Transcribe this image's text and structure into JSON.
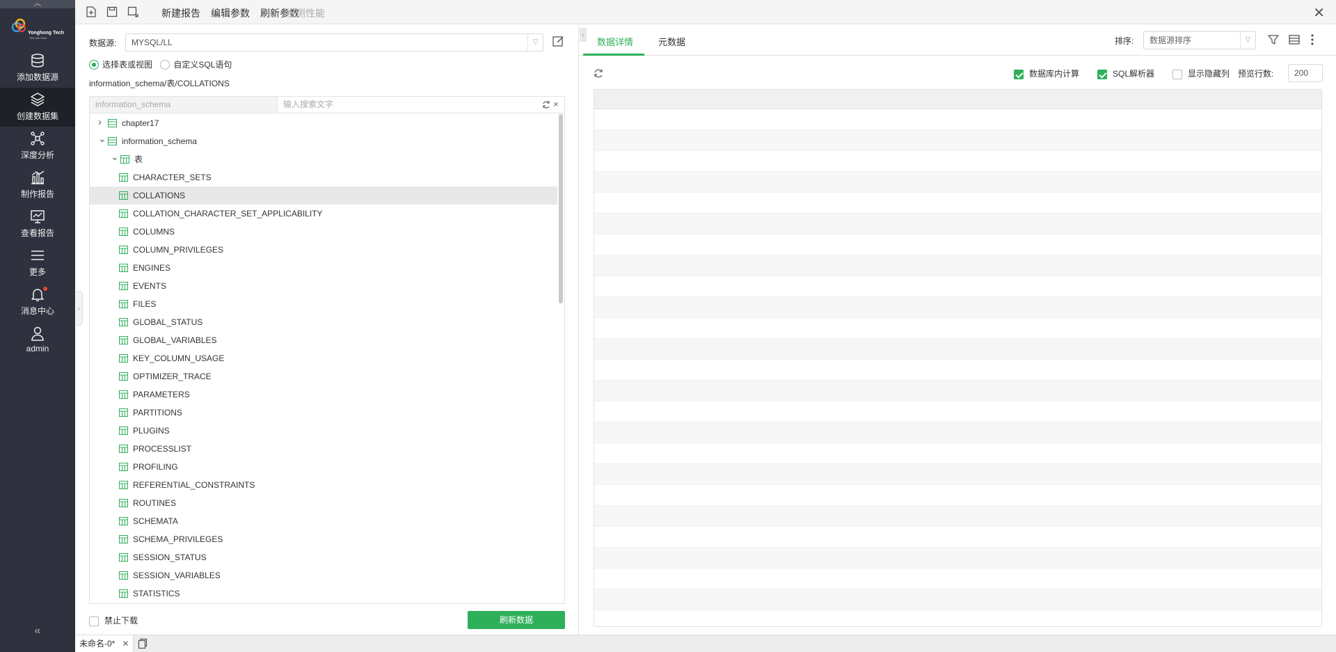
{
  "app": {
    "logo_name": "Yonghong Tech",
    "logo_tagline": "Talk with Data"
  },
  "sidebar": {
    "items": [
      {
        "label": "添加数据源",
        "icon": "database-icon"
      },
      {
        "label": "创建数据集",
        "icon": "layers-icon",
        "active": true
      },
      {
        "label": "深度分析",
        "icon": "network-icon"
      },
      {
        "label": "制作报告",
        "icon": "chart-icon"
      },
      {
        "label": "查看报告",
        "icon": "monitor-chart-icon"
      },
      {
        "label": "更多",
        "icon": "menu-icon"
      },
      {
        "label": "消息中心",
        "icon": "bell-icon"
      },
      {
        "label": "admin",
        "icon": "user-icon"
      }
    ]
  },
  "toolbar": {
    "new_report": "新建报告",
    "edit_params": "编辑参数",
    "refresh_params": "刷新参数",
    "check_perf": "检测性能"
  },
  "left": {
    "datasource_label": "数据源:",
    "datasource_value": "MYSQL/LL",
    "radio_table": "选择表或视图",
    "radio_sql": "自定义SQL语句",
    "path": "information_schema/表/COLLATIONS",
    "tree_db": "information_schema",
    "search_placeholder": "输入搜索文字",
    "tree": [
      {
        "label": "chapter17",
        "level": 0,
        "kind": "db",
        "chev": "right"
      },
      {
        "label": "information_schema",
        "level": 0,
        "kind": "db",
        "chev": "down"
      },
      {
        "label": "表",
        "level": 1,
        "kind": "folder",
        "chev": "down"
      },
      {
        "label": "CHARACTER_SETS",
        "level": 2,
        "kind": "table"
      },
      {
        "label": "COLLATIONS",
        "level": 2,
        "kind": "table",
        "selected": true
      },
      {
        "label": "COLLATION_CHARACTER_SET_APPLICABILITY",
        "level": 2,
        "kind": "table"
      },
      {
        "label": "COLUMNS",
        "level": 2,
        "kind": "table"
      },
      {
        "label": "COLUMN_PRIVILEGES",
        "level": 2,
        "kind": "table"
      },
      {
        "label": "ENGINES",
        "level": 2,
        "kind": "table"
      },
      {
        "label": "EVENTS",
        "level": 2,
        "kind": "table"
      },
      {
        "label": "FILES",
        "level": 2,
        "kind": "table"
      },
      {
        "label": "GLOBAL_STATUS",
        "level": 2,
        "kind": "table"
      },
      {
        "label": "GLOBAL_VARIABLES",
        "level": 2,
        "kind": "table"
      },
      {
        "label": "KEY_COLUMN_USAGE",
        "level": 2,
        "kind": "table"
      },
      {
        "label": "OPTIMIZER_TRACE",
        "level": 2,
        "kind": "table"
      },
      {
        "label": "PARAMETERS",
        "level": 2,
        "kind": "table"
      },
      {
        "label": "PARTITIONS",
        "level": 2,
        "kind": "table"
      },
      {
        "label": "PLUGINS",
        "level": 2,
        "kind": "table"
      },
      {
        "label": "PROCESSLIST",
        "level": 2,
        "kind": "table"
      },
      {
        "label": "PROFILING",
        "level": 2,
        "kind": "table"
      },
      {
        "label": "REFERENTIAL_CONSTRAINTS",
        "level": 2,
        "kind": "table"
      },
      {
        "label": "ROUTINES",
        "level": 2,
        "kind": "table"
      },
      {
        "label": "SCHEMATA",
        "level": 2,
        "kind": "table"
      },
      {
        "label": "SCHEMA_PRIVILEGES",
        "level": 2,
        "kind": "table"
      },
      {
        "label": "SESSION_STATUS",
        "level": 2,
        "kind": "table"
      },
      {
        "label": "SESSION_VARIABLES",
        "level": 2,
        "kind": "table"
      },
      {
        "label": "STATISTICS",
        "level": 2,
        "kind": "table"
      }
    ],
    "no_download": "禁止下载",
    "refresh_data": "刷新数据"
  },
  "right": {
    "tab_detail": "数据详情",
    "tab_meta": "元数据",
    "sort_label": "排序:",
    "sort_value": "数据源排序",
    "db_compute": "数据库内计算",
    "sql_parser": "SQL解析器",
    "show_hidden": "显示隐藏列",
    "preview_label": "预览行数:",
    "preview_rows": "200"
  },
  "bottom": {
    "tab_label": "未命名-0*"
  },
  "colors": {
    "accent": "#2eb05a",
    "sidebar": "#2f323e",
    "selected_row": "#e8e8e8"
  }
}
